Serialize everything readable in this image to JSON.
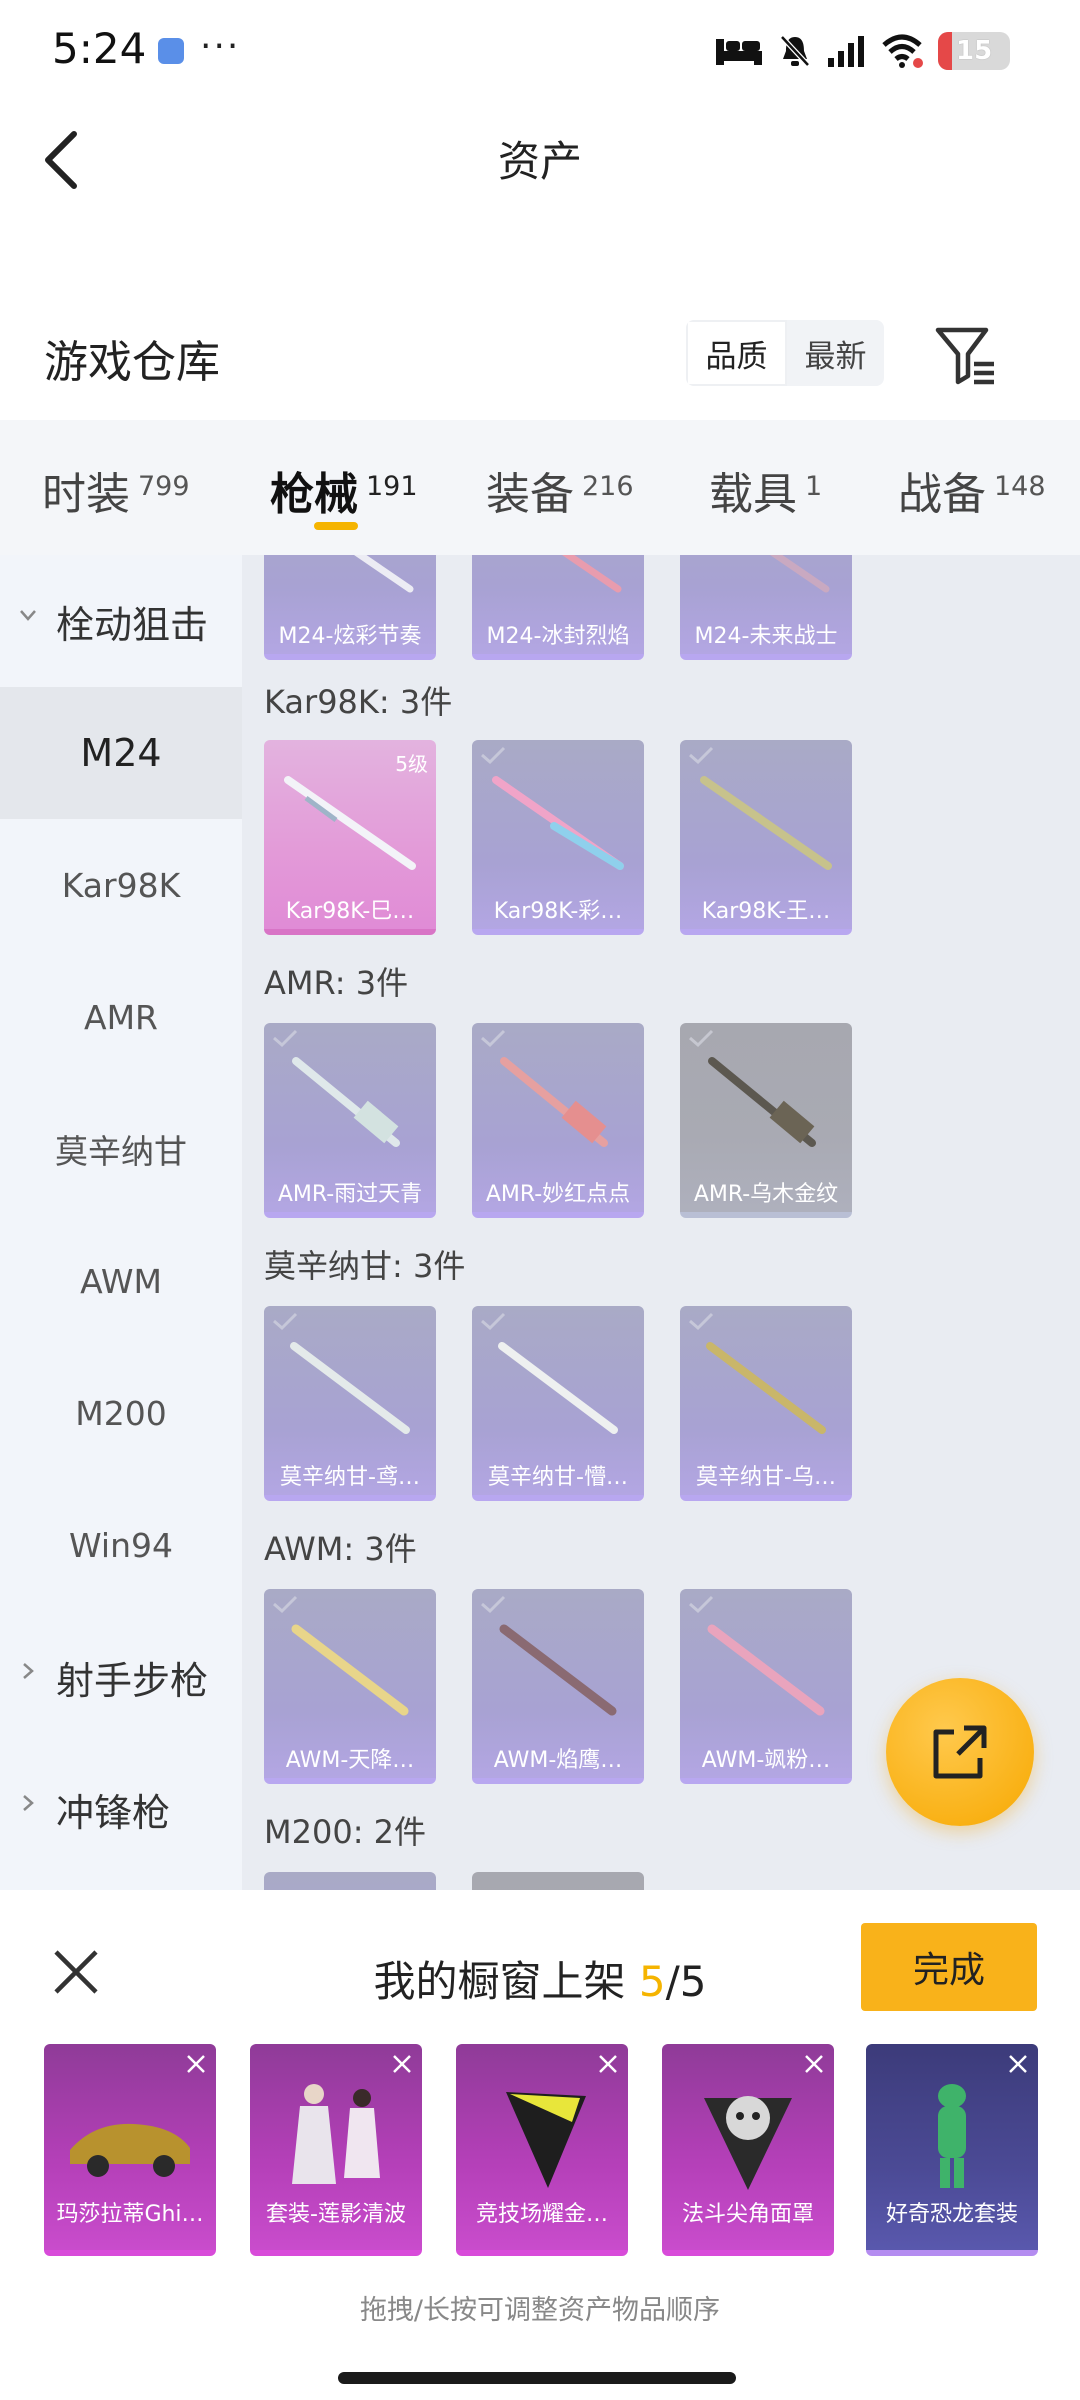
{
  "status_bar": {
    "time": "5:24",
    "more": "···",
    "battery": "15"
  },
  "header": {
    "title": "资产"
  },
  "warehouse": {
    "title": "游戏仓库",
    "sort_options": [
      "品质",
      "最新"
    ],
    "sort_selected": "品质"
  },
  "tabs": [
    {
      "label": "时装",
      "count": "799"
    },
    {
      "label": "枪械",
      "count": "191",
      "active": true
    },
    {
      "label": "装备",
      "count": "216"
    },
    {
      "label": "载具",
      "count": "1"
    },
    {
      "label": "战备",
      "count": "148"
    }
  ],
  "sidebar": {
    "group_sniper": "栓动狙击",
    "items": [
      "M24",
      "Kar98K",
      "AMR",
      "莫辛纳甘",
      "AWM",
      "M200",
      "Win94"
    ],
    "selected": "M24",
    "group_marksman": "射手步枪",
    "group_smg": "冲锋枪"
  },
  "sections": [
    {
      "label": "",
      "items": [
        "M24-炫彩节奏",
        "M24-冰封烈焰",
        "M24-未来战士"
      ]
    },
    {
      "label": "Kar98K: 3件",
      "items": [
        "Kar98K-巳…",
        "Kar98K-彩…",
        "Kar98K-王…"
      ],
      "level": "5级"
    },
    {
      "label": "AMR: 3件",
      "items": [
        "AMR-雨过天青",
        "AMR-妙红点点",
        "AMR-乌木金纹"
      ]
    },
    {
      "label": "莫辛纳甘: 3件",
      "items": [
        "莫辛纳甘-鸢…",
        "莫辛纳甘-懵…",
        "莫辛纳甘-乌…"
      ]
    },
    {
      "label": "AWM: 3件",
      "items": [
        "AWM-天降…",
        "AWM-焰鹰…",
        "AWM-飒粉…"
      ]
    },
    {
      "label": "M200: 2件",
      "items": []
    }
  ],
  "showcase": {
    "title": "我的橱窗上架 ",
    "current": "5",
    "total": "/5",
    "done_label": "完成",
    "items": [
      "玛莎拉蒂Ghi…",
      "套装-莲影清波",
      "竞技场耀金…",
      "法斗尖角面罩",
      "好奇恐龙套装"
    ],
    "hint": "拖拽/长按可调整资产物品顺序"
  },
  "colors": {
    "accent": "#f5b400",
    "done_button": "#f9b21a",
    "epic_purple": "#b33fb7",
    "legendary_pink": "#e39ad8"
  }
}
